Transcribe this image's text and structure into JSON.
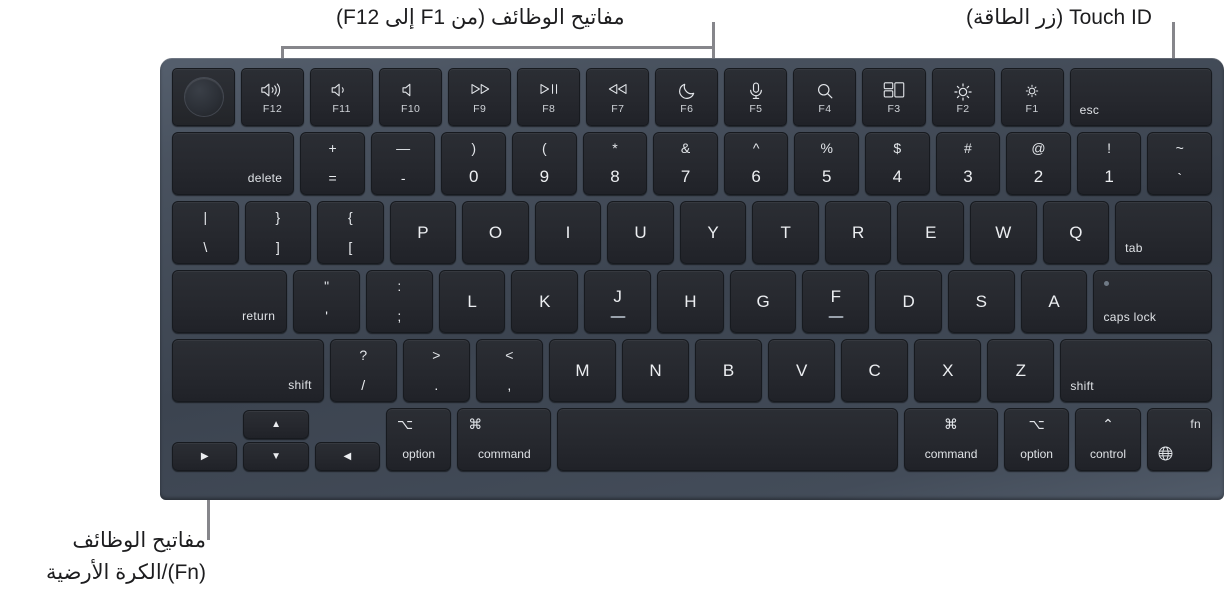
{
  "callouts": {
    "function_keys": "مفاتيح الوظائف (من F1 إلى F12)",
    "touch_id": "Touch ID (زر الطاقة)",
    "fn_key_line1": "مفاتيح الوظائف",
    "fn_key_line2": "(Fn)/الكرة الأرضية"
  },
  "colors": {
    "chassis": "#3c4450",
    "keycap": "#26282e",
    "key_text": "#e8eaed",
    "leader_line": "#86868b",
    "page_background": "#ffffff"
  },
  "keyboard": {
    "function_row": {
      "esc": "esc",
      "keys": [
        {
          "icon": "brightness-down-icon",
          "fn": "F1"
        },
        {
          "icon": "brightness-up-icon",
          "fn": "F2"
        },
        {
          "icon": "mission-control-icon",
          "fn": "F3"
        },
        {
          "icon": "spotlight-search-icon",
          "fn": "F4"
        },
        {
          "icon": "dictation-microphone-icon",
          "fn": "F5"
        },
        {
          "icon": "do-not-disturb-moon-icon",
          "fn": "F6"
        },
        {
          "icon": "rewind-icon",
          "fn": "F7"
        },
        {
          "icon": "play-pause-icon",
          "fn": "F8"
        },
        {
          "icon": "fast-forward-icon",
          "fn": "F9"
        },
        {
          "icon": "mute-icon",
          "fn": "F10"
        },
        {
          "icon": "volume-down-icon",
          "fn": "F11"
        },
        {
          "icon": "volume-up-icon",
          "fn": "F12"
        }
      ],
      "power": "touch-id-power-button"
    },
    "number_row": {
      "keys": [
        {
          "top": "~",
          "bottom": "`"
        },
        {
          "top": "!",
          "bottom": "1"
        },
        {
          "top": "@",
          "bottom": "2"
        },
        {
          "top": "#",
          "bottom": "3"
        },
        {
          "top": "$",
          "bottom": "4"
        },
        {
          "top": "%",
          "bottom": "5"
        },
        {
          "top": "^",
          "bottom": "6"
        },
        {
          "top": "&",
          "bottom": "7"
        },
        {
          "top": "*",
          "bottom": "8"
        },
        {
          "top": "(",
          "bottom": "9"
        },
        {
          "top": ")",
          "bottom": "0"
        },
        {
          "top": "—",
          "bottom": "-"
        },
        {
          "top": "+",
          "bottom": "="
        }
      ],
      "delete": "delete"
    },
    "qwerty_row": {
      "tab": "tab",
      "letters": [
        "Q",
        "W",
        "E",
        "R",
        "T",
        "Y",
        "U",
        "I",
        "O",
        "P"
      ],
      "brackets": [
        {
          "top": "{",
          "bottom": "["
        },
        {
          "top": "}",
          "bottom": "]"
        }
      ],
      "backslash": {
        "top": "|",
        "bottom": "\\"
      }
    },
    "home_row": {
      "caps_lock": "caps lock",
      "letters": [
        "A",
        "S",
        "D",
        "F",
        "G",
        "H",
        "J",
        "K",
        "L"
      ],
      "punct": [
        {
          "top": ":",
          "bottom": ";"
        },
        {
          "top": "\"",
          "bottom": "'"
        }
      ],
      "return": "return"
    },
    "shift_row": {
      "shift_left": "shift",
      "letters": [
        "Z",
        "X",
        "C",
        "V",
        "B",
        "N",
        "M"
      ],
      "punct": [
        {
          "top": "<",
          "bottom": ","
        },
        {
          "top": ">",
          "bottom": "."
        },
        {
          "top": "?",
          "bottom": "/"
        }
      ],
      "shift_right": "shift"
    },
    "bottom_row": {
      "fn": {
        "label": "fn",
        "icon": "globe-icon"
      },
      "control": {
        "symbol": "⌃",
        "label": "control"
      },
      "option_left": {
        "symbol": "⌥",
        "label": "option"
      },
      "command_left": {
        "symbol": "⌘",
        "label": "command"
      },
      "space": "",
      "command_right": {
        "symbol": "⌘",
        "label": "command"
      },
      "option_right": {
        "symbol": "⌥",
        "label": "option"
      },
      "arrows": {
        "left": "◀",
        "up": "▲",
        "down": "▼",
        "right": "▶"
      }
    }
  }
}
